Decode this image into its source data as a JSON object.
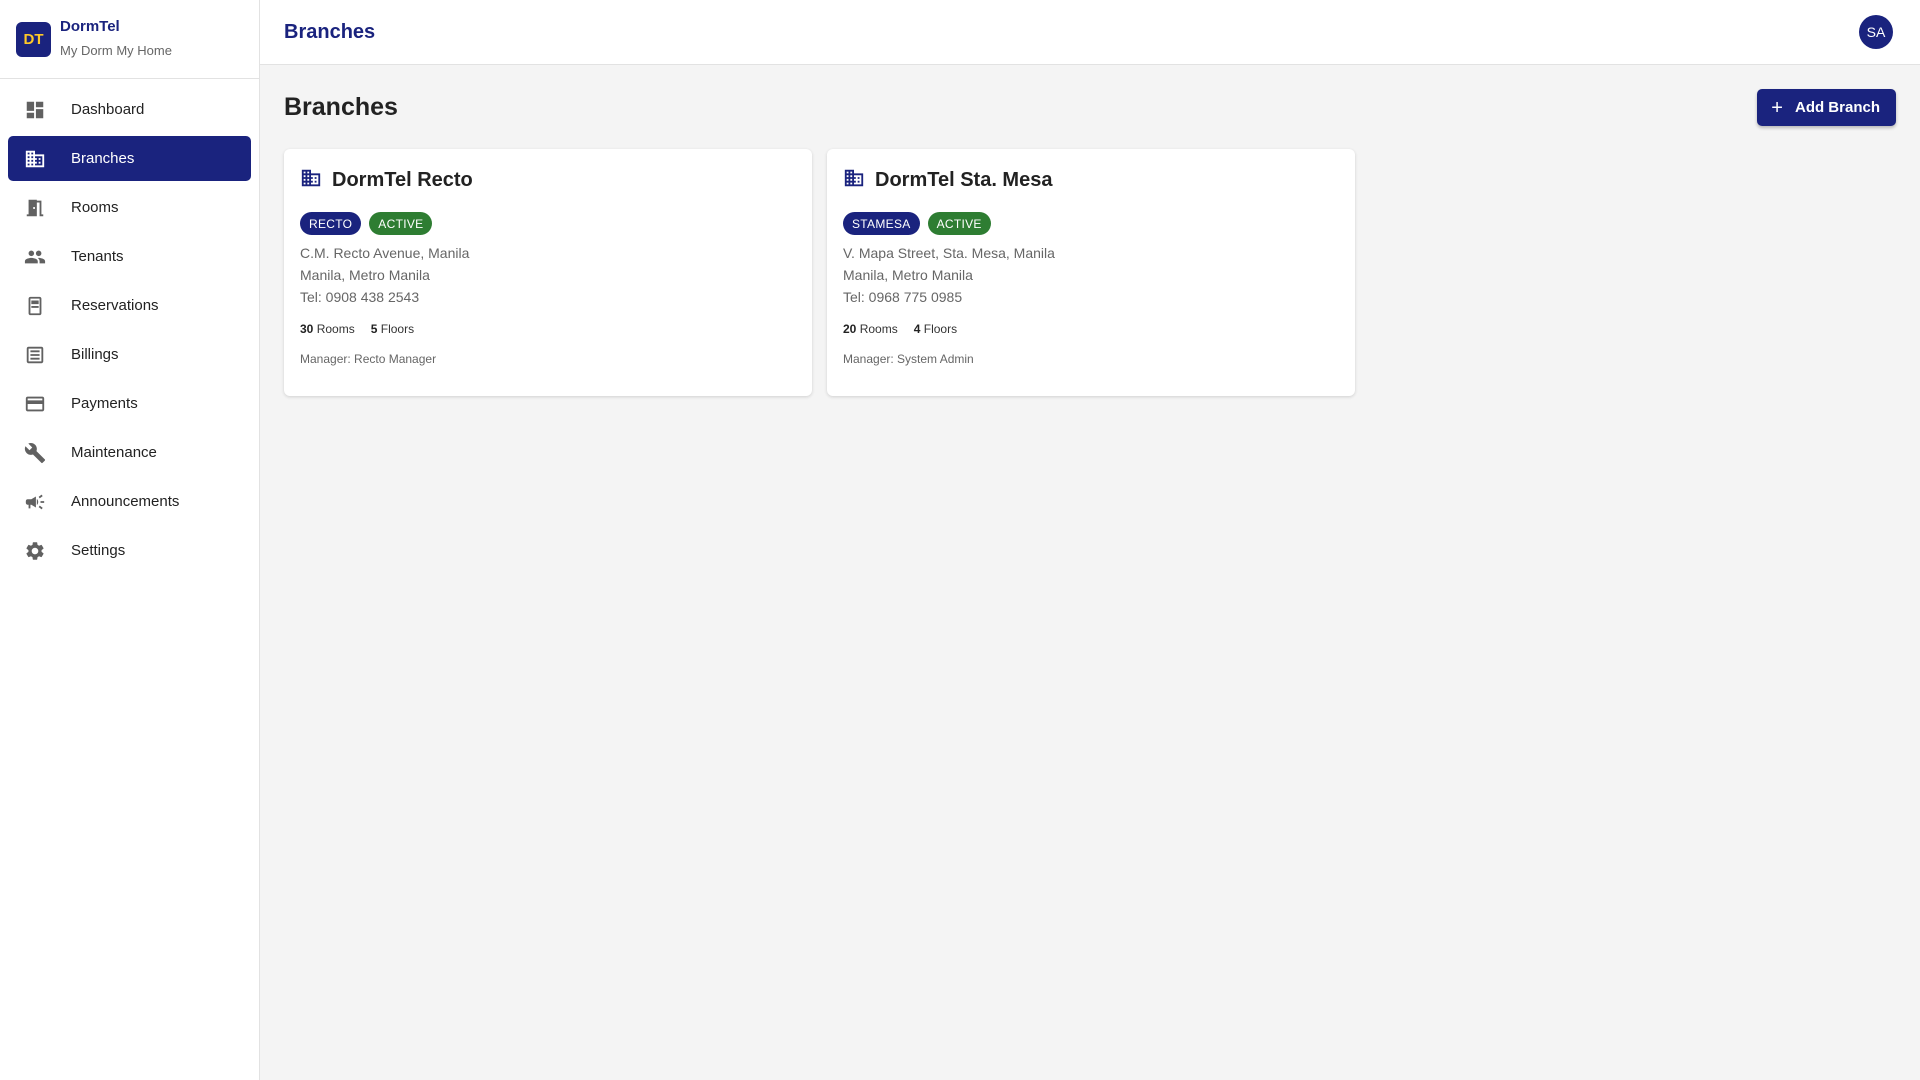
{
  "brand": {
    "initials": "DT",
    "name": "DormTel",
    "tagline": "My Dorm My Home"
  },
  "sidebar": {
    "items": [
      {
        "label": "Dashboard",
        "icon": "dashboard-icon"
      },
      {
        "label": "Branches",
        "icon": "building-icon",
        "active": true
      },
      {
        "label": "Rooms",
        "icon": "door-icon"
      },
      {
        "label": "Tenants",
        "icon": "people-icon"
      },
      {
        "label": "Reservations",
        "icon": "reservation-icon"
      },
      {
        "label": "Billings",
        "icon": "receipt-icon"
      },
      {
        "label": "Payments",
        "icon": "credit-card-icon"
      },
      {
        "label": "Maintenance",
        "icon": "wrench-icon"
      },
      {
        "label": "Announcements",
        "icon": "megaphone-icon"
      },
      {
        "label": "Settings",
        "icon": "gear-icon"
      }
    ]
  },
  "header": {
    "title": "Branches",
    "avatar_initials": "SA"
  },
  "main": {
    "title": "Branches",
    "add_button": "Add Branch",
    "branches": [
      {
        "name": "DormTel Recto",
        "code": "RECTO",
        "status": "ACTIVE",
        "address1": "C.M. Recto Avenue, Manila",
        "address2": "Manila, Metro Manila",
        "phone": "Tel: 0908 438 2543",
        "rooms": "30",
        "rooms_label": "Rooms",
        "floors": "5",
        "floors_label": "Floors",
        "manager": "Manager: Recto Manager"
      },
      {
        "name": "DormTel Sta. Mesa",
        "code": "STAMESA",
        "status": "ACTIVE",
        "address1": "V. Mapa Street, Sta. Mesa, Manila",
        "address2": "Manila, Metro Manila",
        "phone": "Tel: 0968 775 0985",
        "rooms": "20",
        "rooms_label": "Rooms",
        "floors": "4",
        "floors_label": "Floors",
        "manager": "Manager: System Admin"
      }
    ]
  },
  "colors": {
    "primary": "#1a237e",
    "success": "#2e7d32",
    "accent": "#ffc928"
  }
}
